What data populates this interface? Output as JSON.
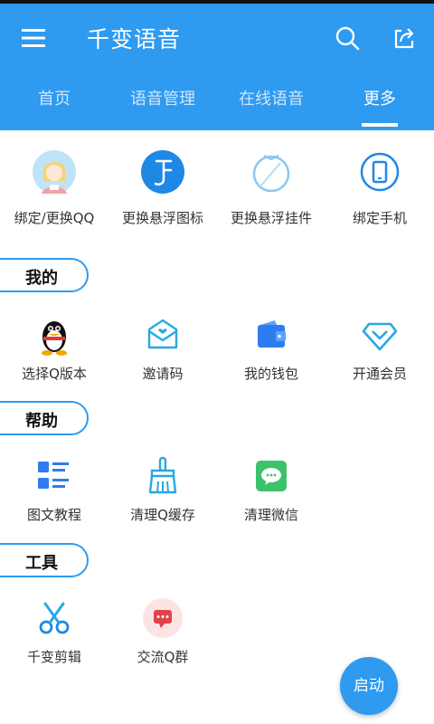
{
  "header": {
    "title": "千变语音",
    "menu_icon": "hamburger-menu-icon",
    "search_icon": "search-icon",
    "share_icon": "share-icon",
    "bg_color": "#2e9af0"
  },
  "tabs": [
    {
      "label": "首页"
    },
    {
      "label": "语音管理"
    },
    {
      "label": "在线语音"
    },
    {
      "label": "更多",
      "active": true
    }
  ],
  "top_actions": [
    {
      "label": "绑定/更换QQ",
      "icon": "qq-avatar-icon"
    },
    {
      "label": "更换悬浮图标",
      "icon": "music-note-icon"
    },
    {
      "label": "更换悬浮挂件",
      "icon": "ring-pendant-icon"
    },
    {
      "label": "绑定手机",
      "icon": "phone-icon"
    }
  ],
  "sections": [
    {
      "title": "我的",
      "items": [
        {
          "label": "选择Q版本",
          "icon": "qq-penguin-icon"
        },
        {
          "label": "邀请码",
          "icon": "invite-envelope-icon"
        },
        {
          "label": "我的钱包",
          "icon": "wallet-icon"
        },
        {
          "label": "开通会员",
          "icon": "diamond-icon"
        }
      ]
    },
    {
      "title": "帮助",
      "items": [
        {
          "label": "图文教程",
          "icon": "tutorial-list-icon"
        },
        {
          "label": "清理Q缓存",
          "icon": "broom-icon"
        },
        {
          "label": "清理微信",
          "icon": "wechat-icon"
        }
      ]
    },
    {
      "title": "工具",
      "items": [
        {
          "label": "千变剪辑",
          "icon": "scissors-icon"
        },
        {
          "label": "交流Q群",
          "icon": "chat-bubble-icon"
        }
      ]
    }
  ],
  "fab": {
    "label": "启动"
  }
}
